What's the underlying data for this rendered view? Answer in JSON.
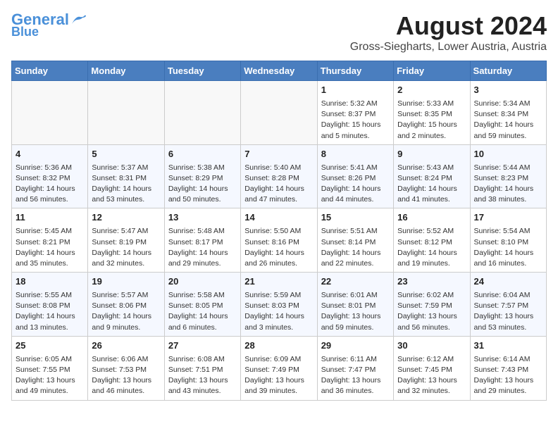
{
  "header": {
    "logo_line1": "General",
    "logo_line2": "Blue",
    "title": "August 2024",
    "subtitle": "Gross-Siegharts, Lower Austria, Austria"
  },
  "calendar": {
    "days_of_week": [
      "Sunday",
      "Monday",
      "Tuesday",
      "Wednesday",
      "Thursday",
      "Friday",
      "Saturday"
    ],
    "weeks": [
      [
        {
          "day": "",
          "info": ""
        },
        {
          "day": "",
          "info": ""
        },
        {
          "day": "",
          "info": ""
        },
        {
          "day": "",
          "info": ""
        },
        {
          "day": "1",
          "info": "Sunrise: 5:32 AM\nSunset: 8:37 PM\nDaylight: 15 hours and 5 minutes."
        },
        {
          "day": "2",
          "info": "Sunrise: 5:33 AM\nSunset: 8:35 PM\nDaylight: 15 hours and 2 minutes."
        },
        {
          "day": "3",
          "info": "Sunrise: 5:34 AM\nSunset: 8:34 PM\nDaylight: 14 hours and 59 minutes."
        }
      ],
      [
        {
          "day": "4",
          "info": "Sunrise: 5:36 AM\nSunset: 8:32 PM\nDaylight: 14 hours and 56 minutes."
        },
        {
          "day": "5",
          "info": "Sunrise: 5:37 AM\nSunset: 8:31 PM\nDaylight: 14 hours and 53 minutes."
        },
        {
          "day": "6",
          "info": "Sunrise: 5:38 AM\nSunset: 8:29 PM\nDaylight: 14 hours and 50 minutes."
        },
        {
          "day": "7",
          "info": "Sunrise: 5:40 AM\nSunset: 8:28 PM\nDaylight: 14 hours and 47 minutes."
        },
        {
          "day": "8",
          "info": "Sunrise: 5:41 AM\nSunset: 8:26 PM\nDaylight: 14 hours and 44 minutes."
        },
        {
          "day": "9",
          "info": "Sunrise: 5:43 AM\nSunset: 8:24 PM\nDaylight: 14 hours and 41 minutes."
        },
        {
          "day": "10",
          "info": "Sunrise: 5:44 AM\nSunset: 8:23 PM\nDaylight: 14 hours and 38 minutes."
        }
      ],
      [
        {
          "day": "11",
          "info": "Sunrise: 5:45 AM\nSunset: 8:21 PM\nDaylight: 14 hours and 35 minutes."
        },
        {
          "day": "12",
          "info": "Sunrise: 5:47 AM\nSunset: 8:19 PM\nDaylight: 14 hours and 32 minutes."
        },
        {
          "day": "13",
          "info": "Sunrise: 5:48 AM\nSunset: 8:17 PM\nDaylight: 14 hours and 29 minutes."
        },
        {
          "day": "14",
          "info": "Sunrise: 5:50 AM\nSunset: 8:16 PM\nDaylight: 14 hours and 26 minutes."
        },
        {
          "day": "15",
          "info": "Sunrise: 5:51 AM\nSunset: 8:14 PM\nDaylight: 14 hours and 22 minutes."
        },
        {
          "day": "16",
          "info": "Sunrise: 5:52 AM\nSunset: 8:12 PM\nDaylight: 14 hours and 19 minutes."
        },
        {
          "day": "17",
          "info": "Sunrise: 5:54 AM\nSunset: 8:10 PM\nDaylight: 14 hours and 16 minutes."
        }
      ],
      [
        {
          "day": "18",
          "info": "Sunrise: 5:55 AM\nSunset: 8:08 PM\nDaylight: 14 hours and 13 minutes."
        },
        {
          "day": "19",
          "info": "Sunrise: 5:57 AM\nSunset: 8:06 PM\nDaylight: 14 hours and 9 minutes."
        },
        {
          "day": "20",
          "info": "Sunrise: 5:58 AM\nSunset: 8:05 PM\nDaylight: 14 hours and 6 minutes."
        },
        {
          "day": "21",
          "info": "Sunrise: 5:59 AM\nSunset: 8:03 PM\nDaylight: 14 hours and 3 minutes."
        },
        {
          "day": "22",
          "info": "Sunrise: 6:01 AM\nSunset: 8:01 PM\nDaylight: 13 hours and 59 minutes."
        },
        {
          "day": "23",
          "info": "Sunrise: 6:02 AM\nSunset: 7:59 PM\nDaylight: 13 hours and 56 minutes."
        },
        {
          "day": "24",
          "info": "Sunrise: 6:04 AM\nSunset: 7:57 PM\nDaylight: 13 hours and 53 minutes."
        }
      ],
      [
        {
          "day": "25",
          "info": "Sunrise: 6:05 AM\nSunset: 7:55 PM\nDaylight: 13 hours and 49 minutes."
        },
        {
          "day": "26",
          "info": "Sunrise: 6:06 AM\nSunset: 7:53 PM\nDaylight: 13 hours and 46 minutes."
        },
        {
          "day": "27",
          "info": "Sunrise: 6:08 AM\nSunset: 7:51 PM\nDaylight: 13 hours and 43 minutes."
        },
        {
          "day": "28",
          "info": "Sunrise: 6:09 AM\nSunset: 7:49 PM\nDaylight: 13 hours and 39 minutes."
        },
        {
          "day": "29",
          "info": "Sunrise: 6:11 AM\nSunset: 7:47 PM\nDaylight: 13 hours and 36 minutes."
        },
        {
          "day": "30",
          "info": "Sunrise: 6:12 AM\nSunset: 7:45 PM\nDaylight: 13 hours and 32 minutes."
        },
        {
          "day": "31",
          "info": "Sunrise: 6:14 AM\nSunset: 7:43 PM\nDaylight: 13 hours and 29 minutes."
        }
      ]
    ]
  }
}
